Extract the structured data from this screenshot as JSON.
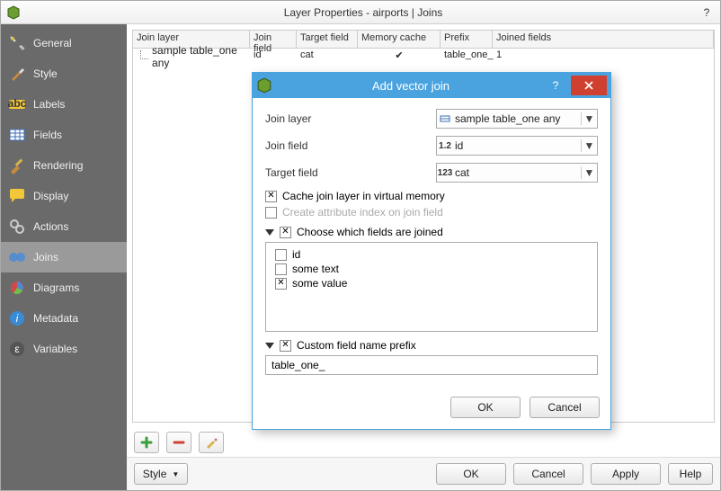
{
  "window": {
    "title": "Layer Properties - airports | Joins"
  },
  "sidebar": {
    "items": [
      {
        "label": "General"
      },
      {
        "label": "Style"
      },
      {
        "label": "Labels"
      },
      {
        "label": "Fields"
      },
      {
        "label": "Rendering"
      },
      {
        "label": "Display"
      },
      {
        "label": "Actions"
      },
      {
        "label": "Joins"
      },
      {
        "label": "Diagrams"
      },
      {
        "label": "Metadata"
      },
      {
        "label": "Variables"
      }
    ],
    "active_index": 7
  },
  "joins_table": {
    "headers": [
      "Join layer",
      "Join field",
      "Target field",
      "Memory cache",
      "Prefix",
      "Joined fields"
    ],
    "rows": [
      {
        "layer": "sample table_one any",
        "join_field": "id",
        "target_field": "cat",
        "memory_cache": "✔",
        "prefix": "table_one_",
        "joined_fields": "1"
      }
    ]
  },
  "footer": {
    "style_label": "Style",
    "ok": "OK",
    "cancel": "Cancel",
    "apply": "Apply",
    "help": "Help"
  },
  "modal": {
    "title": "Add vector join",
    "join_layer_label": "Join layer",
    "join_layer_value": "sample table_one any",
    "join_field_label": "Join field",
    "join_field_prefix": "1.2",
    "join_field_value": "id",
    "target_field_label": "Target field",
    "target_field_prefix": "123",
    "target_field_value": "cat",
    "cache_label": "Cache join layer in virtual memory",
    "cache_checked": true,
    "create_index_label": "Create attribute index on join field",
    "create_index_checked": false,
    "choose_fields_label": "Choose which fields are joined",
    "choose_fields_checked": true,
    "fields": [
      {
        "label": "id",
        "checked": false
      },
      {
        "label": "some text",
        "checked": false
      },
      {
        "label": "some value",
        "checked": true
      }
    ],
    "prefix_group_label": "Custom field name prefix",
    "prefix_group_checked": true,
    "prefix_value": "table_one_",
    "ok": "OK",
    "cancel": "Cancel"
  }
}
